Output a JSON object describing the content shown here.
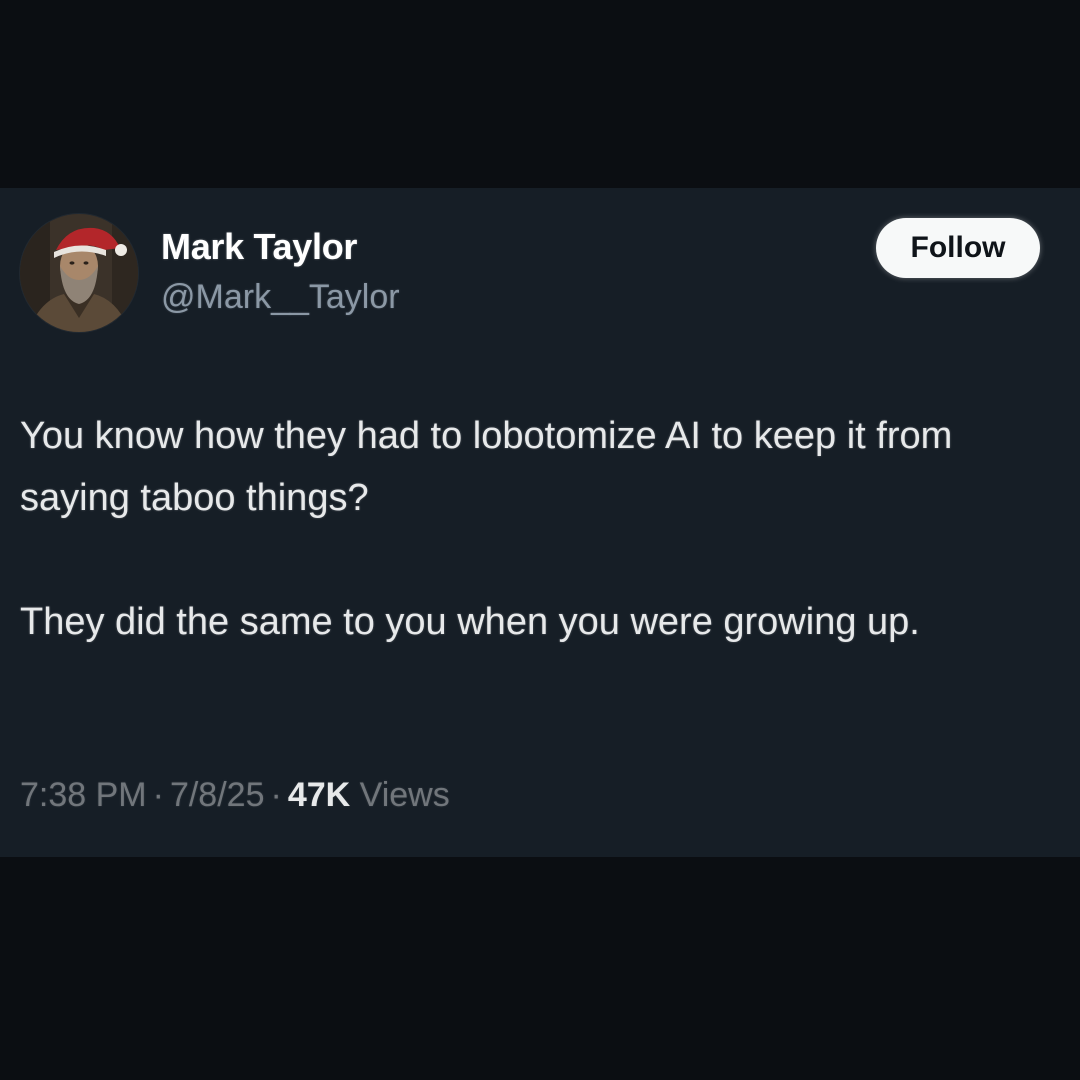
{
  "user": {
    "display_name": "Mark Taylor",
    "handle": "@Mark__Taylor",
    "avatar_icon": "bearded-man-santa-hat-avatar"
  },
  "follow_button": {
    "label": "Follow"
  },
  "tweet": {
    "paragraph_1": "You know how they had to lobotomize AI to keep it from saying taboo things?",
    "paragraph_2": "They did the same to you when you were growing up.",
    "time": "7:38 PM",
    "date": "7/8/25",
    "separator": "·",
    "views_count": "47K",
    "views_label": "Views"
  },
  "colors": {
    "background": "#0b0e12",
    "card": "#161e26",
    "text_primary": "#e7e9ea",
    "text_secondary": "#8b98a5",
    "follow_button_bg": "#f7f9f9"
  }
}
